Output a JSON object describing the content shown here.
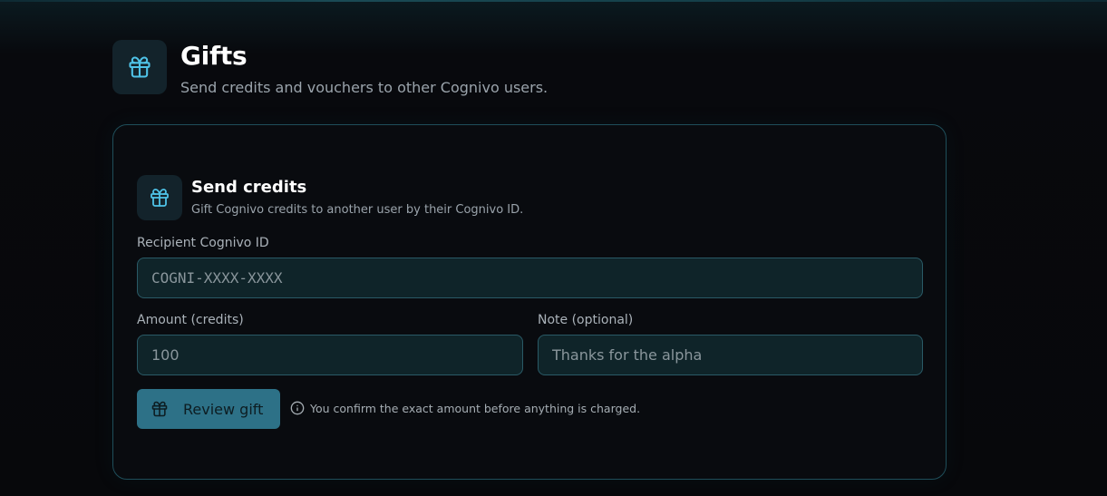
{
  "header": {
    "title": "Gifts",
    "subtitle": "Send credits and vouchers to other Cognivo users.",
    "icon": "gift-icon"
  },
  "send_credits": {
    "title": "Send credits",
    "subtitle": "Gift Cognivo credits to another user by their Cognivo ID.",
    "icon": "gift-icon",
    "recipient": {
      "label": "Recipient Cognivo ID",
      "placeholder": "COGNI-XXXX-XXXX",
      "value": ""
    },
    "amount": {
      "label": "Amount (credits)",
      "placeholder": "100",
      "value": ""
    },
    "note": {
      "label": "Note (optional)",
      "placeholder": "Thanks for the alpha",
      "value": ""
    },
    "review_button": {
      "label": "Review gift",
      "icon": "gift-icon"
    },
    "hint": {
      "icon": "info-icon",
      "text": "You confirm the exact amount before anything is charged."
    }
  },
  "colors": {
    "accent": "#4fc3e8",
    "button": "#2d7187",
    "card_border": "#1f4e5a",
    "field_bg": "#0f2429"
  }
}
